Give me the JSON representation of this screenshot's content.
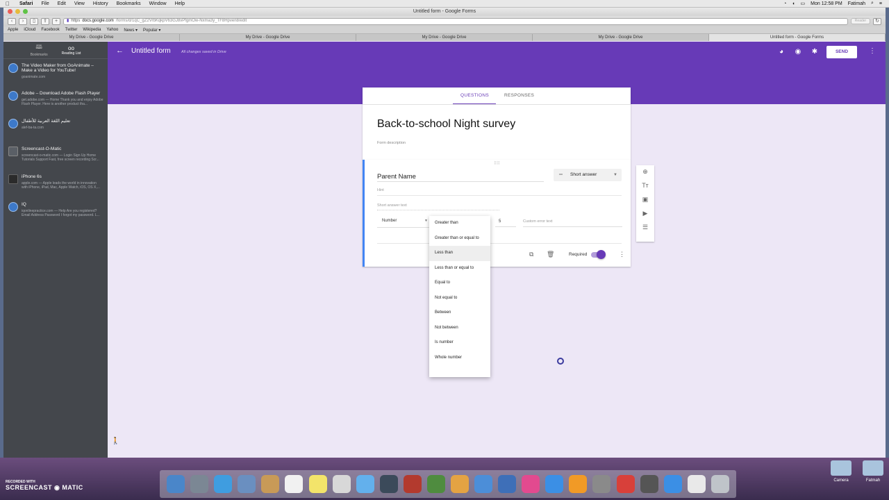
{
  "menubar": {
    "app": "Safari",
    "items": [
      "File",
      "Edit",
      "View",
      "History",
      "Bookmarks",
      "Window",
      "Help"
    ],
    "clock": "Mon 12:58 PM",
    "user": "Fatimah"
  },
  "window": {
    "title": "Untitled form - Google Forms",
    "url_prefix": "https",
    "url_host": "docs.google.com",
    "url_path": "/forms/d/1qC_gZ2VrbKqkpV63GJ8vPfgmOw-Nxma3y_TF8Hpven8/edit",
    "reader": "Reader",
    "favorites": [
      "Apple",
      "iCloud",
      "Facebook",
      "Twitter",
      "Wikipedia",
      "Yahoo",
      "News ▾",
      "Popular ▾"
    ],
    "tabs": [
      "My Drive - Google Drive",
      "My Drive - Google Drive",
      "My Drive - Google Drive",
      "My Drive - Google Drive",
      "Untitled form - Google Forms"
    ]
  },
  "sidebar": {
    "bookmarks_label": "Bookmarks",
    "reading_list_label": "Reading List",
    "items": [
      {
        "title": "The Video Maker from GoAnimate – Make a Video for YouTube!",
        "desc": "goanimate.com",
        "icon": "globe-icon"
      },
      {
        "title": "Adobe – Download Adobe Flash Player",
        "desc": "get.adobe.com — Home Thank you and enjoy Adobe Flash Player. Here is another product tha...",
        "icon": "globe-icon"
      },
      {
        "title": "تعليم اللغة العربية للأطفال",
        "desc": "alef-ba-ta.com",
        "icon": "globe-icon"
      },
      {
        "title": "Screencast-O-Matic",
        "desc": "screencast-o-matic.com — Login Sign Up Home Tutorials Support Fast, free screen recording Scr...",
        "icon": "screencast-icon"
      },
      {
        "title": "iPhone 6s",
        "desc": "apple.com — Apple leads the world in innovation with iPhone, iPad, Mac, Apple Watch, iOS, OS X,...",
        "icon": "apple-icon"
      },
      {
        "title": "IQ",
        "desc": "iqonlinepractice.com — Help Are you registered? Email Address Password I forgot my password. L...",
        "icon": "globe-icon"
      }
    ]
  },
  "forms": {
    "header": {
      "title": "Untitled form",
      "saved": "All changes saved in Drive",
      "send": "SEND"
    },
    "tabs": {
      "questions": "QUESTIONS",
      "responses": "RESPONSES"
    },
    "title": "Back-to-school Night survey",
    "description_placeholder": "Form description",
    "question": {
      "title": "Parent Name",
      "type": "Short answer",
      "hint": "Hint",
      "short_answer_text": "Short answer text",
      "validation_type": "Number",
      "value": "5",
      "error_placeholder": "Custom error text",
      "required_label": "Required"
    },
    "dropdown": {
      "options": [
        "Greater than",
        "Greater than or equal to",
        "Less than",
        "Less than or equal to",
        "Equal to",
        "Not equal to",
        "Between",
        "Not between",
        "Is number",
        "Whole number"
      ],
      "highlighted": "Less than"
    }
  },
  "desktop": {
    "watermark_top": "RECORDED WITH",
    "watermark_bottom": "SCREENCAST",
    "watermark_suffix": "MATIC",
    "folders": [
      "Camera",
      "Fatmah"
    ]
  },
  "colors": {
    "forms_purple": "#673ab7",
    "forms_bg": "#ede7f6",
    "focus_blue": "#4285f4"
  }
}
